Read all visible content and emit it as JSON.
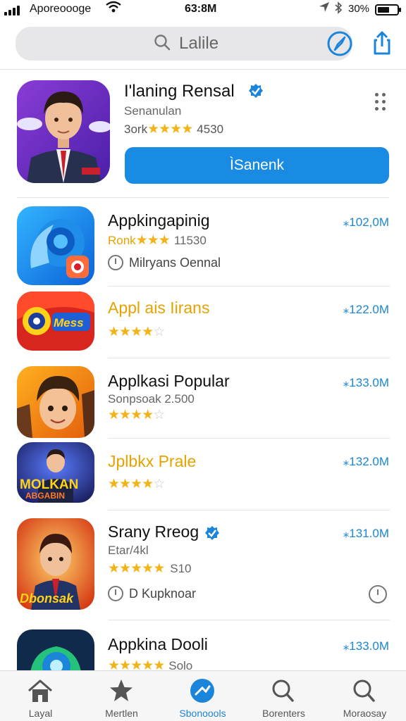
{
  "status_bar": {
    "carrier": "Aporeoooge",
    "time": "63:8M",
    "battery": "30%",
    "battery_level": 0.6
  },
  "header": {
    "search_query": "Lalile",
    "icons": [
      "search-icon",
      "compass-icon",
      "share-icon"
    ]
  },
  "featured": {
    "title": "I'laning Rensal",
    "subtitle": "Senanulan",
    "rating_prefix": "3ork",
    "rating_count": "4530",
    "stars": 4,
    "button_label": "ÌSanenk"
  },
  "apps": [
    {
      "title": "Appkingapinig",
      "size": "⁎102,0M",
      "rating_prefix": "Ronk",
      "rating_count": "11530",
      "stars": 3,
      "sub": "Milryans Oennal"
    },
    {
      "title": "Appl  ais Iirans",
      "size": "⁎122.0M",
      "stars": 4,
      "stars_total": 5
    },
    {
      "title": "Applkasi Popular",
      "size": "⁎133.0M",
      "meta": "Sonpsoak  2.500",
      "stars": 4,
      "stars_total": 5
    },
    {
      "title": "Jplbkx Prale",
      "size": "⁎132.0M",
      "stars": 4,
      "stars_total": 5
    },
    {
      "title": "Srany Rreog",
      "size": "⁎131.0M",
      "meta": "Etar/4kl",
      "rating_count": "S10",
      "stars": 5,
      "sub": "D Kupknoar"
    },
    {
      "title": "Appkina Dooli",
      "size": "⁎133.0M",
      "rating_count": "Solo",
      "stars": 5
    }
  ],
  "tabs": [
    {
      "label": "Layal",
      "icon": "home-icon"
    },
    {
      "label": "Mertlen",
      "icon": "star-icon"
    },
    {
      "label": "Sbonoools",
      "icon": "apps-icon",
      "active": true
    },
    {
      "label": "Borenters",
      "icon": "search-icon"
    },
    {
      "label": "Moraosay",
      "icon": "search-icon"
    }
  ],
  "colors": {
    "accent": "#1a8be2",
    "star": "#f2b318",
    "gold_title": "#e6a300"
  }
}
